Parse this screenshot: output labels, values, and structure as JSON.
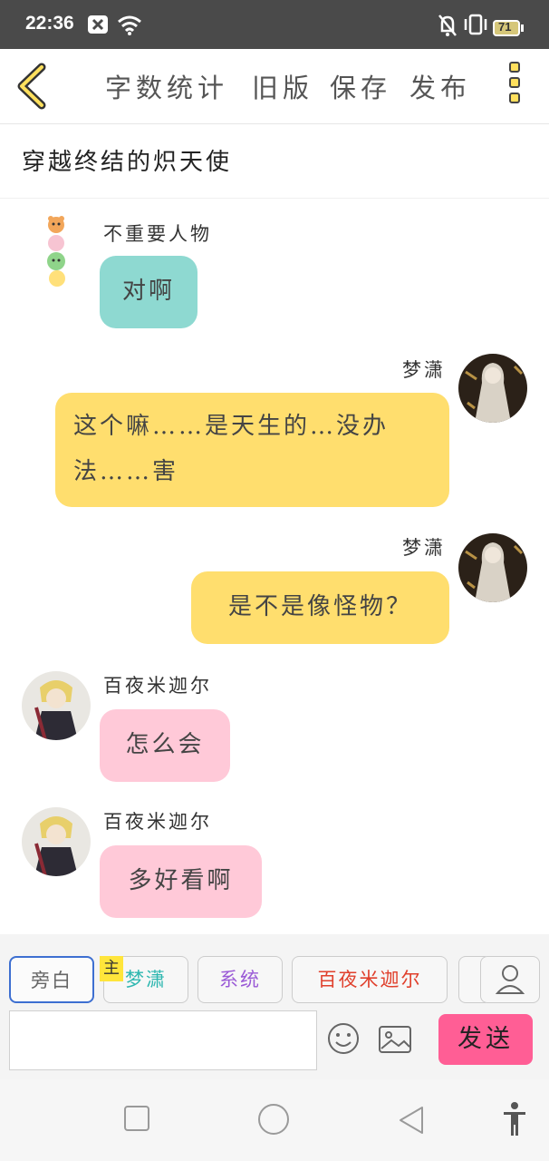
{
  "status_bar": {
    "time": "22:36",
    "battery": "71"
  },
  "toolbar": {
    "word_count": "字数统计",
    "old_version": "旧版",
    "save": "保存",
    "publish": "发布"
  },
  "story": {
    "title": "穿越终结的炽天使"
  },
  "messages": [
    {
      "name": "不重要人物",
      "text": "对啊"
    },
    {
      "name": "梦潇",
      "text_line1": "这个嘛……是天生的…没办",
      "text_line2": "法……害"
    },
    {
      "name": "梦潇",
      "text": "是不是像怪物？"
    },
    {
      "name": "百夜米迦尔",
      "text": "怎么会"
    },
    {
      "name": "百夜米迦尔",
      "text": "多好看啊"
    }
  ],
  "roles": {
    "narration": "旁白",
    "main_tag": "主",
    "mengxiao": "梦潇",
    "system": "系统",
    "mikaela": "百夜米迦尔"
  },
  "composer": {
    "send": "发送"
  },
  "colors": {
    "teal_bubble": "#8ed9d1",
    "yellow_bubble": "#ffde6e",
    "pink_bubble": "#ffc9d8",
    "send_button": "#ff5e95",
    "accent_yellow": "#ffe05d"
  }
}
